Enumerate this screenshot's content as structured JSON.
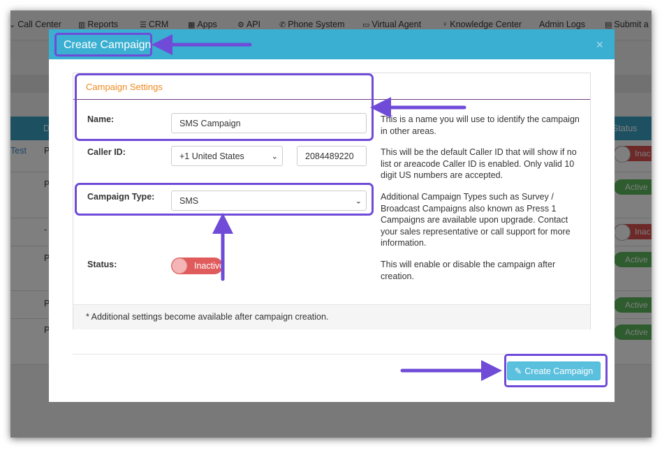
{
  "nav": {
    "items": [
      {
        "icon": "chevron-down-icon",
        "glyph": "⌄",
        "label": "Call Center"
      },
      {
        "icon": "bar-chart-icon",
        "glyph": "📊",
        "label": "Reports"
      },
      {
        "icon": "list-icon",
        "glyph": "☰",
        "label": "CRM"
      },
      {
        "icon": "grid-icon",
        "glyph": "⁞⁞⁞",
        "label": "Apps"
      },
      {
        "icon": "gear-icon",
        "glyph": "⚙",
        "label": "API"
      },
      {
        "icon": "phone-icon",
        "glyph": "✆",
        "label": "Phone System"
      },
      {
        "icon": "monitor-icon",
        "glyph": "🖵",
        "label": "Virtual Agent"
      },
      {
        "icon": "lightbulb-icon",
        "glyph": "💡",
        "label": "Knowledge Center"
      },
      {
        "icon": "",
        "glyph": "",
        "label": "Admin Logs"
      },
      {
        "icon": "ticket-icon",
        "glyph": "🎫",
        "label": "Submit a"
      }
    ]
  },
  "table": {
    "col_d": "D",
    "col_status": "Status",
    "rows": [
      {
        "name": "Test",
        "d": "P",
        "status": "Inac"
      },
      {
        "name": "",
        "d": "P",
        "status": "Active"
      },
      {
        "name": "",
        "d": "-",
        "status": "Inac"
      },
      {
        "name": "",
        "d": "P",
        "status": "Active"
      },
      {
        "name": "",
        "d": "P",
        "status": "Active"
      },
      {
        "name": "",
        "d": "P",
        "status": "Active"
      }
    ]
  },
  "modal": {
    "title": "Create Campaign",
    "close_glyph": "×",
    "panel_title": "Campaign Settings",
    "name_label": "Name:",
    "name_value": "SMS Campaign",
    "name_help": "This is a name you will use to identify the campaign in other areas.",
    "callerid_label": "Caller ID:",
    "country_value": "+1 United States",
    "callerid_value": "2084489220",
    "callerid_help": "This will be the default Caller ID that will show if no list or areacode Caller ID is enabled. Only valid 10 digit US numbers are accepted.",
    "type_label": "Campaign Type:",
    "type_value": "SMS",
    "type_help": "Additional Campaign Types such as Survey / Broadcast Campaigns also known as Press 1 Campaigns are available upon upgrade. Contact your sales representative or call support for more information.",
    "status_label": "Status:",
    "status_value": "Inactive",
    "status_help": "This will enable or disable the campaign after creation.",
    "footer_note": "* Additional settings become available after campaign creation.",
    "create_button": "Create Campaign",
    "create_icon": "edit-icon"
  },
  "colors": {
    "header": "#3aafd2",
    "highlight": "#6f4bd8",
    "accent_orange": "#ef8a1e",
    "button": "#5bc0de"
  }
}
